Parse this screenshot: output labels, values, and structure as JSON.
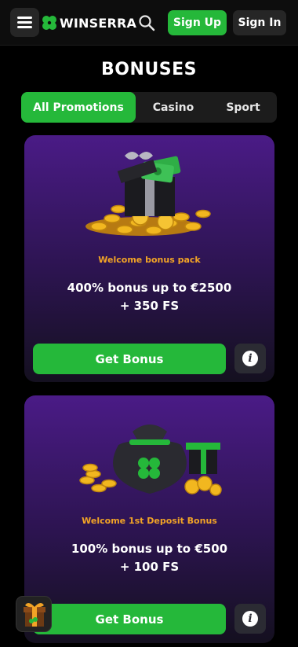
{
  "header": {
    "logo_text": "WINSERRA",
    "signup_label": "Sign Up",
    "signin_label": "Sign In"
  },
  "page": {
    "title": "BONUSES"
  },
  "tabs": [
    {
      "label": "All Promotions",
      "active": true
    },
    {
      "label": "Casino",
      "active": false
    },
    {
      "label": "Sport",
      "active": false
    }
  ],
  "bonuses": [
    {
      "kicker": "Welcome bonus pack",
      "line1": "400% bonus up to €2500",
      "line2": "+ 350 FS",
      "button_label": "Get Bonus",
      "info_label": "i",
      "art": "gift-box-with-coins-icon"
    },
    {
      "kicker": "Welcome 1st Deposit Bonus",
      "line1": "100% bonus up to €500",
      "line2": "+ 100 FS",
      "button_label": "Get Bonus",
      "info_label": "i",
      "art": "money-bag-with-gifts-icon"
    }
  ],
  "colors": {
    "accent": "#25b83a",
    "kicker": "#f2a426",
    "card_top": "#4a1b86",
    "background": "#000000"
  }
}
